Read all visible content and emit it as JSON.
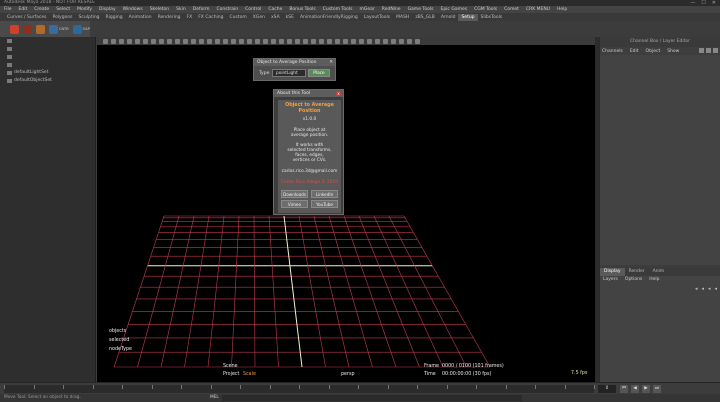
{
  "window": {
    "title": "Autodesk Maya 2018 - NOT FOR RESALE",
    "buttons": [
      "—",
      "☐",
      "✕"
    ]
  },
  "menubar": [
    "File",
    "Edit",
    "Create",
    "Select",
    "Modify",
    "Display",
    "Windows",
    "Skeleton",
    "Skin",
    "Deform",
    "Constrain",
    "Control",
    "Cache",
    "Bonus Tools",
    "Custom Tools",
    "mGear",
    "RedNine",
    "Game Tools",
    "Epic Games",
    "CGM Tools",
    "Comet",
    "CRK MENU",
    "Help"
  ],
  "shelf_tabs": [
    {
      "label": "Curves / Surfaces",
      "active": false
    },
    {
      "label": "Polygons",
      "active": false
    },
    {
      "label": "Sculpting",
      "active": false
    },
    {
      "label": "Rigging",
      "active": false
    },
    {
      "label": "Animation",
      "active": false
    },
    {
      "label": "Rendering",
      "active": false
    },
    {
      "label": "FX",
      "active": false
    },
    {
      "label": "FX Caching",
      "active": false
    },
    {
      "label": "Custom",
      "active": false
    },
    {
      "label": "XGen",
      "active": false
    },
    {
      "label": "xSA",
      "active": false
    },
    {
      "label": "kSE",
      "active": false
    },
    {
      "label": "AnimationFriendlyRigging",
      "active": false
    },
    {
      "label": "LayoutTools",
      "active": false
    },
    {
      "label": "MASH",
      "active": false
    },
    {
      "label": "zBS_GLB",
      "active": false
    },
    {
      "label": "Arnold",
      "active": false
    },
    {
      "label": "Setup",
      "active": true
    },
    {
      "label": "SlibsTools",
      "active": false
    }
  ],
  "shelf_icons": [
    {
      "name": "tomato-icon",
      "color": "#d0402a",
      "label": ""
    },
    {
      "name": "brush-icon",
      "color": "#8a3020",
      "label": ""
    },
    {
      "name": "curve-icon",
      "color": "#b06a2a",
      "label": ""
    },
    {
      "name": "center-icon",
      "color": "#3a6aa0",
      "label": "CNTR"
    },
    {
      "name": "oap-icon",
      "color": "#2a6a9a",
      "label": "OAP"
    }
  ],
  "outliner": {
    "rows": [
      {
        "label": "",
        "name": "outliner-row-1"
      },
      {
        "label": "",
        "name": "outliner-row-2"
      },
      {
        "label": "",
        "name": "outliner-row-3"
      },
      {
        "label": "",
        "name": "outliner-row-4"
      },
      {
        "label": "defaultLightSet",
        "name": "outliner-row-default-light-set"
      },
      {
        "label": "defaultObjectSet",
        "name": "outliner-row-default-object-set"
      }
    ]
  },
  "oap_window": {
    "title": "Object to Average Position",
    "close": "✕",
    "type_label": "Type",
    "type_value": "pointLight",
    "place_label": "Place"
  },
  "about_window": {
    "title": "About this Tool",
    "close": "x",
    "heading1": "Object to Average",
    "heading2": "Position",
    "version": "v1.0.0",
    "desc1": "Place object at",
    "desc2": "average position.",
    "desc3": "It works with",
    "desc4": "selected transforms,",
    "desc5": "faces, edges,",
    "desc6": "vertices or CVs.",
    "email": "carlos.rico.3d@gmail.com",
    "copyright": "Carlos Rico Adega © 2019",
    "btn_downloads": "Downloads",
    "btn_linkedin": "LinkedIn",
    "btn_vimeo": "Vimeo",
    "btn_youtube": "YouTube"
  },
  "hud": {
    "objects_label": "objects",
    "selected_label": "selected",
    "nodetype_label": "nodeType",
    "scene_label": "Scene",
    "project_label": "Project",
    "project_value": "Scale",
    "camera": "persp",
    "frame_label": "Frame",
    "frame_value": "0000 / 0100 (101 frames)",
    "time_label": "Time",
    "time_value": "00:00:00:00 (30 fps)",
    "fps": "7.5 fps"
  },
  "channel_box": {
    "header": "Channel Box / Layer Editor",
    "tabs": [
      "Channels",
      "Edit",
      "Object",
      "Show"
    ]
  },
  "layer_editor": {
    "tabs": [
      {
        "label": "Display",
        "active": true
      },
      {
        "label": "Render",
        "active": false
      },
      {
        "label": "Anim",
        "active": false
      }
    ],
    "menu": [
      "Layers",
      "Options",
      "Help"
    ]
  },
  "timeslider": {
    "current_frame": "0",
    "playback": [
      "⏮",
      "◀",
      "▶",
      "⏭"
    ]
  },
  "statusline": {
    "message": "Move Tool: Select an object to drag.",
    "mel_label": "MEL"
  },
  "grid": {
    "axis_color": "#f5f2c8",
    "line_color": "#c23a4e"
  }
}
